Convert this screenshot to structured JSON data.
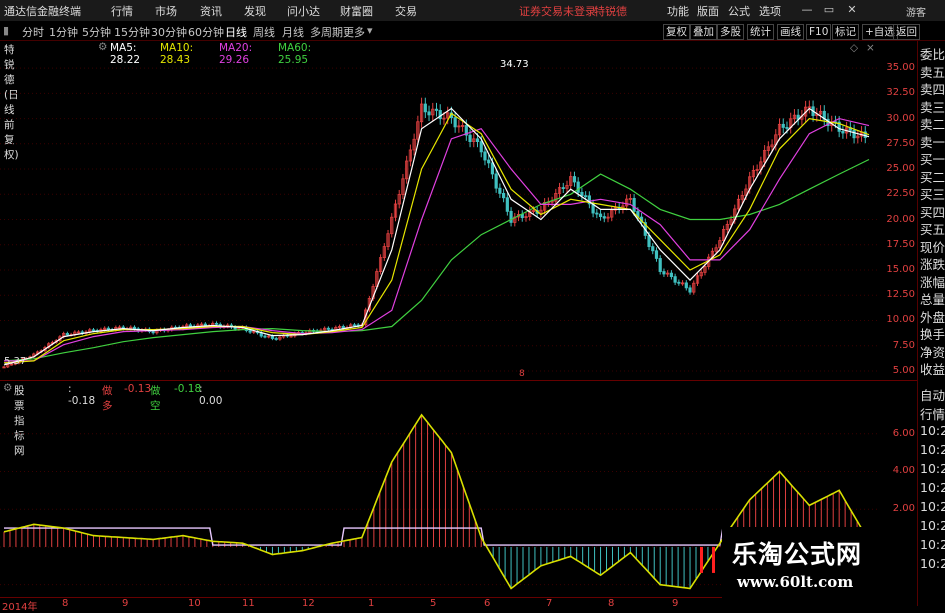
{
  "window": {
    "title": "通达信金融终端",
    "warning": "证券交易未登录",
    "user": "特锐德",
    "menus": [
      "行情",
      "市场",
      "资讯",
      "发现",
      "问小达",
      "财富圈",
      "交易"
    ],
    "right_menus": [
      "功能",
      "版面",
      "公式",
      "选项"
    ],
    "login": "游客"
  },
  "periods": [
    "分时",
    "1分钟",
    "5分钟",
    "15分钟",
    "30分钟",
    "60分钟",
    "日线",
    "周线",
    "月线",
    "多周期",
    "更多"
  ],
  "active_period": "日线",
  "toolbar_right": [
    "复权",
    "叠加",
    "多股",
    "统计",
    "画线",
    "F10",
    "标记",
    "+自选",
    "返回"
  ],
  "stock": {
    "title": "特锐德(日线 前复权)",
    "ma": [
      {
        "label": "MA5: 28.22",
        "color": "#ffffff"
      },
      {
        "label": "MA10: 28.43",
        "color": "#e6e600"
      },
      {
        "label": "MA20: 29.26",
        "color": "#e040e0"
      },
      {
        "label": "MA60: 25.95",
        "color": "#40d040"
      }
    ],
    "high_label": "34.73",
    "low_label": "5.37",
    "marker": "8"
  },
  "price_ticks": [
    "35.00",
    "32.50",
    "30.00",
    "27.50",
    "25.00",
    "22.50",
    "20.00",
    "17.50",
    "15.00",
    "12.50",
    "10.00",
    "7.50",
    "5.00"
  ],
  "right_panel": [
    "委比",
    "卖五",
    "卖四",
    "卖三",
    "卖二",
    "卖一",
    "买一",
    "买二",
    "买三",
    "买四",
    "买五",
    "现价",
    "涨跌",
    "涨幅",
    "总量",
    "外盘",
    "换手",
    "净资",
    "收益"
  ],
  "right_panel2": [
    "自动",
    "行情",
    "10:2",
    "10:2",
    "10:2",
    "10:2",
    "10:2",
    "10:2",
    "10:2",
    "10:2"
  ],
  "indicator": {
    "name": "股票指标网",
    "value": ": -0.18",
    "duo_label": "做多",
    "duo_value": "-0.13",
    "kong_label": "做空",
    "kong_value": "-0.18",
    "extra": ": 0.00"
  },
  "ind_ticks": [
    "6.00",
    "4.00",
    "2.00",
    "0.00",
    "-2.00"
  ],
  "time_ticks": [
    "2014年",
    "8",
    "9",
    "10",
    "11",
    "12",
    "1",
    "5",
    "6",
    "7",
    "8",
    "9"
  ],
  "watermark": {
    "line1": "乐淘公式网",
    "line2": "www.60lt.com"
  },
  "chart_data": {
    "type": "candlestick",
    "title": "特锐德(日线 前复权)",
    "ylim": [
      4.5,
      36
    ],
    "x": [
      "2014年",
      "8",
      "9",
      "10",
      "11",
      "12",
      "1",
      "5",
      "6",
      "7",
      "8",
      "9"
    ],
    "close": [
      5.4,
      6.6,
      8.6,
      9.0,
      9.3,
      8.9,
      9.4,
      9.6,
      9.2,
      8.2,
      8.8,
      9.2,
      9.6,
      20,
      31,
      30,
      27,
      20,
      21,
      24,
      20,
      22,
      15,
      13,
      18,
      24,
      29,
      31,
      29,
      28
    ],
    "ma5": [
      5.6,
      6.4,
      8.4,
      8.9,
      9.2,
      9.0,
      9.3,
      9.5,
      9.3,
      8.5,
      8.6,
      9.0,
      9.5,
      17,
      29,
      31,
      28,
      22,
      20,
      23,
      21,
      21,
      17,
      14,
      17,
      23,
      28,
      31,
      29,
      28.2
    ],
    "ma10": [
      5.8,
      6.0,
      8.0,
      8.7,
      9.1,
      9.1,
      9.2,
      9.4,
      9.4,
      8.8,
      8.6,
      8.9,
      9.3,
      14,
      25,
      30.5,
      28.5,
      23,
      20.5,
      22,
      21.5,
      21,
      18,
      15,
      16.5,
      21,
      27,
      30,
      29.5,
      28.4
    ],
    "ma20": [
      6.0,
      6.0,
      7.6,
      8.4,
      8.9,
      9.0,
      9.1,
      9.3,
      9.4,
      9.0,
      8.7,
      8.8,
      9.1,
      11,
      20,
      28,
      29,
      25,
      21.5,
      21.5,
      22,
      21.5,
      19.5,
      16,
      16,
      19,
      24,
      28.5,
      30,
      29.3
    ],
    "ma60": [
      6.0,
      6.2,
      6.8,
      7.3,
      7.9,
      8.3,
      8.6,
      8.9,
      9.1,
      9.2,
      9.0,
      8.9,
      9.0,
      9.4,
      12,
      16,
      18.5,
      20,
      21.5,
      22.5,
      24.5,
      23,
      21,
      20,
      20,
      20.5,
      21.5,
      23,
      24.5,
      25.95
    ],
    "indicator": {
      "name": "股票指标网",
      "ylim": [
        -2.6,
        8
      ],
      "values": [
        0.8,
        1.2,
        1.0,
        0.6,
        0.5,
        0.4,
        0.6,
        0.3,
        0.2,
        -0.4,
        -0.2,
        0.2,
        0.5,
        4.5,
        7.0,
        5.0,
        0.5,
        -2.2,
        -1.0,
        -0.5,
        -1.5,
        -0.3,
        -2.0,
        -2.2,
        0.2,
        2.5,
        4.0,
        2.2,
        3.0,
        0.3
      ]
    }
  }
}
